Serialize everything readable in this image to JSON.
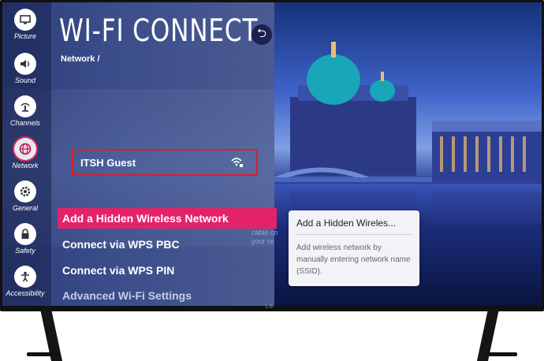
{
  "sidebar": {
    "items": [
      {
        "label": "Picture",
        "icon": "picture-icon"
      },
      {
        "label": "Sound",
        "icon": "speaker-icon"
      },
      {
        "label": "Channels",
        "icon": "antenna-icon"
      },
      {
        "label": "Network",
        "icon": "globe-icon",
        "active": true
      },
      {
        "label": "General",
        "icon": "gear-icon"
      },
      {
        "label": "Safety",
        "icon": "lock-icon"
      },
      {
        "label": "Accessibility",
        "icon": "person-icon"
      }
    ]
  },
  "header": {
    "title": "WI-FI CONNECT",
    "breadcrumb": "Network /"
  },
  "network": {
    "name": "ITSH Guest",
    "icon": "wifi-secure-icon"
  },
  "menu": {
    "items": [
      {
        "label": "Add a Hidden Wireless Network",
        "active": true
      },
      {
        "label": "Connect via WPS PBC"
      },
      {
        "label": "Connect via WPS PIN"
      },
      {
        "label": "Advanced Wi-Fi Settings"
      }
    ]
  },
  "ghost_text": [
    "cable co",
    "your re"
  ],
  "tooltip": {
    "title": "Add a Hidden Wireles...",
    "body": "Add wireless network by manually entering network name (SSID)."
  },
  "brand": "LG",
  "colors": {
    "accent": "#e4226a",
    "highlight_border": "#d8202a"
  }
}
